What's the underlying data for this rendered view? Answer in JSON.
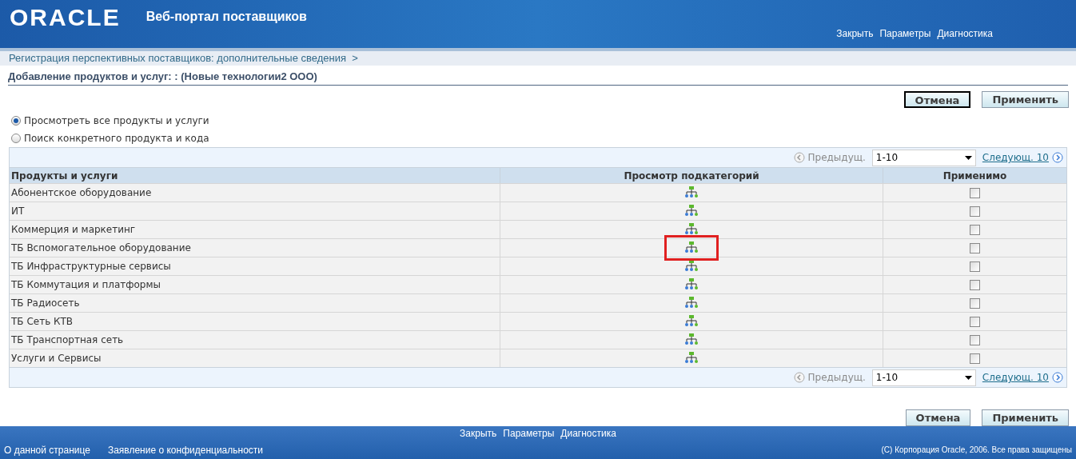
{
  "header": {
    "logo": "ORACLE",
    "title": "Веб-портал поставщиков",
    "links": [
      "Закрыть",
      "Параметры",
      "Диагностика"
    ]
  },
  "breadcrumb": "Регистрация перспективных поставщиков: дополнительные сведения  >",
  "page_title": "Добавление продуктов и услуг: : (Новые технологии2 ООО)",
  "buttons": [
    {
      "label": "Отмена",
      "selected": true
    },
    {
      "label": "Применить",
      "selected": false
    }
  ],
  "radios": [
    {
      "label": "Просмотреть все продукты и услуги",
      "selected": true
    },
    {
      "label": "Поиск конкретного продукта и кода",
      "selected": false
    }
  ],
  "pagers": [
    {
      "previous": "Предыдущ.",
      "range": "1-10",
      "next": "Следующ. 10"
    },
    {
      "previous": "Предыдущ.",
      "range": "1-10",
      "next": "Следующ. 10"
    }
  ],
  "table": {
    "columns": [
      "Продукты и услуги",
      "Просмотр подкатегорий",
      "Применимо"
    ],
    "rows": [
      {
        "name": "Абонентское оборудование",
        "checked": false,
        "highlighted": false
      },
      {
        "name": "ИТ",
        "checked": false,
        "highlighted": false
      },
      {
        "name": "Коммерция и маркетинг",
        "checked": false,
        "highlighted": false
      },
      {
        "name": "ТБ Вспомогательное оборудование",
        "checked": false,
        "highlighted": true
      },
      {
        "name": "ТБ Инфраструктурные сервисы",
        "checked": false,
        "highlighted": false
      },
      {
        "name": "ТБ Коммутация и платформы",
        "checked": false,
        "highlighted": false
      },
      {
        "name": "ТБ Радиосеть",
        "checked": false,
        "highlighted": false
      },
      {
        "name": "ТБ Сеть КТВ",
        "checked": false,
        "highlighted": false
      },
      {
        "name": "ТБ Транспортная сеть",
        "checked": false,
        "highlighted": false
      },
      {
        "name": "Услуги и Сервисы",
        "checked": false,
        "highlighted": false
      }
    ]
  },
  "bottom_buttons": [
    {
      "label": "Отмена",
      "selected": false
    },
    {
      "label": "Применить",
      "selected": false
    }
  ],
  "footer": {
    "links": [
      "Закрыть",
      "Параметры",
      "Диагностика"
    ],
    "left_links": [
      "О данной странице",
      "Заявление о конфиденциальности"
    ],
    "copyright": "(C) Корпорация Oracle, 2006. Все права защищены"
  }
}
